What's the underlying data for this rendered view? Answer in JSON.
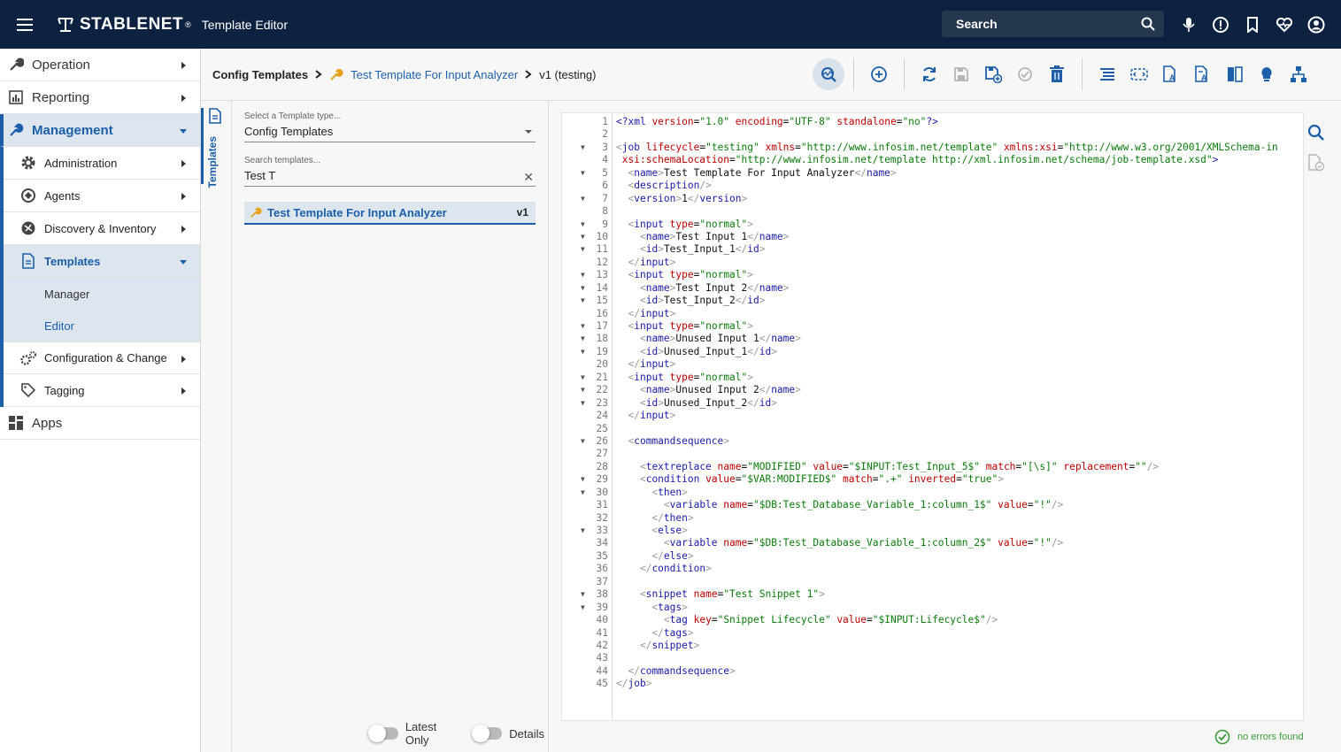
{
  "header": {
    "brand": "STABLENET",
    "brand_reg": "®",
    "app_title": "Template Editor",
    "search_placeholder": "Search"
  },
  "sidebar": {
    "items": [
      {
        "label": "Operation"
      },
      {
        "label": "Reporting"
      },
      {
        "label": "Management"
      },
      {
        "label": "Administration"
      },
      {
        "label": "Agents"
      },
      {
        "label": "Discovery & Inventory"
      },
      {
        "label": "Templates"
      },
      {
        "label": "Manager"
      },
      {
        "label": "Editor"
      },
      {
        "label": "Configuration & Change"
      },
      {
        "label": "Tagging"
      },
      {
        "label": "Apps"
      }
    ]
  },
  "breadcrumb": {
    "root": "Config Templates",
    "template": "Test Template For Input Analyzer",
    "version": "v1 (testing)"
  },
  "panel": {
    "rail_label": "Templates",
    "type_label": "Select a Template type...",
    "type_value": "Config Templates",
    "search_label": "Search templates...",
    "search_value": "Test T",
    "result_name": "Test Template For Input Analyzer",
    "result_version": "v1",
    "latest_only": "Latest Only",
    "details": "Details"
  },
  "editor": {
    "lines": [
      "<?xml version=\"1.0\" encoding=\"UTF-8\" standalone=\"no\"?>",
      "",
      "<job lifecycle=\"testing\" xmlns=\"http://www.infosim.net/template\" xmlns:xsi=\"http://www.w3.org/2001/XMLSchema-in",
      " xsi:schemaLocation=\"http://www.infosim.net/template http://xml.infosim.net/schema/job-template.xsd\">",
      "  <name>Test Template For Input Analyzer</name>",
      "  <description/>",
      "  <version>1</version>",
      "",
      "  <input type=\"normal\">",
      "    <name>Test Input 1</name>",
      "    <id>Test_Input_1</id>",
      "  </input>",
      "  <input type=\"normal\">",
      "    <name>Test Input 2</name>",
      "    <id>Test_Input_2</id>",
      "  </input>",
      "  <input type=\"normal\">",
      "    <name>Unused Input 1</name>",
      "    <id>Unused_Input_1</id>",
      "  </input>",
      "  <input type=\"normal\">",
      "    <name>Unused Input 2</name>",
      "    <id>Unused_Input_2</id>",
      "  </input>",
      "",
      "  <commandsequence>",
      "",
      "    <textreplace name=\"MODIFIED\" value=\"$INPUT:Test_Input_5$\" match=\"[\\s]\" replacement=\"\"/>",
      "    <condition value=\"$VAR:MODIFIED$\" match=\".+\" inverted=\"true\">",
      "      <then>",
      "        <variable name=\"$DB:Test_Database_Variable_1:column_1$\" value=\"!\"/>",
      "      </then>",
      "      <else>",
      "        <variable name=\"$DB:Test_Database_Variable_1:column_2$\" value=\"!\"/>",
      "      </else>",
      "    </condition>",
      "",
      "    <snippet name=\"Test Snippet 1\">",
      "      <tags>",
      "        <tag key=\"Snippet Lifecycle\" value=\"$INPUT:Lifecycle$\"/>",
      "      </tags>",
      "    </snippet>",
      "",
      "  </commandsequence>",
      "</job>"
    ],
    "folds": [
      3,
      5,
      7,
      9,
      10,
      11,
      13,
      14,
      15,
      17,
      18,
      19,
      21,
      22,
      23,
      26,
      29,
      30,
      33,
      38,
      39
    ]
  },
  "status": {
    "text": "no errors found"
  },
  "colors": {
    "header_bg": "#0d2240",
    "accent": "#1c5fa8",
    "selected_bg": "#dde6ef",
    "ok": "#3a9a3a"
  }
}
